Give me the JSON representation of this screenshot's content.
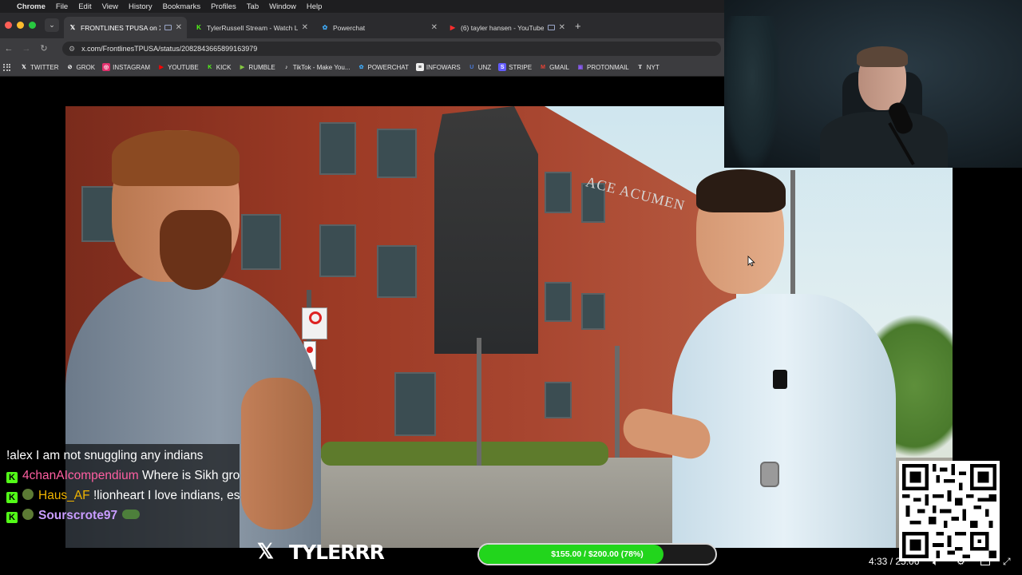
{
  "menubar": {
    "apple_icon": "apple-icon",
    "app_name": "Chrome",
    "items": [
      "File",
      "Edit",
      "View",
      "History",
      "Bookmarks",
      "Profiles",
      "Tab",
      "Window",
      "Help"
    ]
  },
  "tabs": [
    {
      "title": "FRONTLINES TPUSA on X",
      "favicon": "x-logo-icon",
      "active": true
    },
    {
      "title": "TylerRussell Stream - Watch Li",
      "favicon": "kick-logo-icon",
      "active": false
    },
    {
      "title": "Powerchat",
      "favicon": "powerchat-icon",
      "active": false
    },
    {
      "title": "(6) tayler hansen - YouTube",
      "favicon": "youtube-icon",
      "active": false
    }
  ],
  "address_bar": {
    "url": "x.com/FrontlinesTPUSA/status/2082843665899163979"
  },
  "bookmarks": [
    {
      "label": "TWITTER",
      "icon": "x-logo-icon",
      "color": "#ffffff"
    },
    {
      "label": "GROK",
      "icon": "grok-icon",
      "color": "#ffffff"
    },
    {
      "label": "INSTAGRAM",
      "icon": "instagram-icon",
      "color": "#e1306c"
    },
    {
      "label": "YOUTUBE",
      "icon": "youtube-icon",
      "color": "#ff0000"
    },
    {
      "label": "KICK",
      "icon": "kick-logo-icon",
      "color": "#53fc18"
    },
    {
      "label": "RUMBLE",
      "icon": "rumble-icon",
      "color": "#85c742"
    },
    {
      "label": "TikTok - Make You...",
      "icon": "tiktok-icon",
      "color": "#ffffff"
    },
    {
      "label": "POWERCHAT",
      "icon": "powerchat-icon",
      "color": "#3fa9f5"
    },
    {
      "label": "INFOWARS",
      "icon": "infowars-icon",
      "color": "#ffffff"
    },
    {
      "label": "UNZ",
      "icon": "unz-icon",
      "color": "#4a7bd8"
    },
    {
      "label": "STRIPE",
      "icon": "stripe-icon",
      "color": "#635bff"
    },
    {
      "label": "GMAIL",
      "icon": "gmail-icon",
      "color": "#ea4335"
    },
    {
      "label": "PROTONMAIL",
      "icon": "protonmail-icon",
      "color": "#8b5cf6"
    },
    {
      "label": "NYT",
      "icon": "nyt-icon",
      "color": "#ffffff"
    }
  ],
  "video": {
    "building_sign": "ACE ACUMEN"
  },
  "chat": [
    {
      "user": "",
      "message": "!alex I am not snuggling any indians"
    },
    {
      "user": "4chanAIcompendium",
      "message": "Where is Sikh groyper???"
    },
    {
      "user": "Haus_AF",
      "message": "!lionheart I love indians, especially the women"
    },
    {
      "user": "Sourscrote97",
      "message": ""
    }
  ],
  "overlay": {
    "brand": "TYLERRR",
    "goal_label": "$155.00 / $200.00 (78%)",
    "goal_fraction": 0.78
  },
  "player": {
    "timecode": "4:33 / 25:06"
  },
  "colors": {
    "kick_green": "#53fc18",
    "goal_green": "#22d51c"
  }
}
